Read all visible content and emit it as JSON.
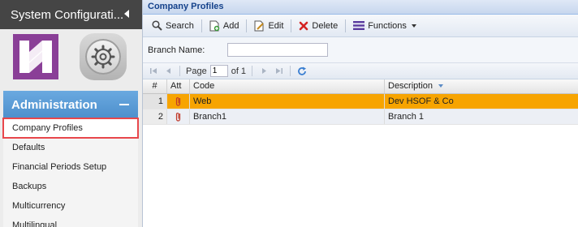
{
  "sidebar": {
    "title": "System Configurati...",
    "section": "Administration",
    "items": [
      {
        "label": "Company Profiles"
      },
      {
        "label": "Defaults"
      },
      {
        "label": "Financial Periods Setup"
      },
      {
        "label": "Backups"
      },
      {
        "label": "Multicurrency"
      },
      {
        "label": "Multilingual"
      }
    ]
  },
  "panel": {
    "title": "Company Profiles"
  },
  "toolbar": {
    "search": "Search",
    "add": "Add",
    "edit": "Edit",
    "delete": "Delete",
    "functions": "Functions"
  },
  "filter": {
    "branch_name_label": "Branch Name:",
    "branch_name_value": ""
  },
  "pager": {
    "page_label": "Page",
    "page_value": "1",
    "of_label": "of 1"
  },
  "grid": {
    "columns": {
      "num": "#",
      "att": "Att",
      "code": "Code",
      "description": "Description"
    },
    "rows": [
      {
        "num": "1",
        "code": "Web",
        "description": "Dev HSOF & Co"
      },
      {
        "num": "2",
        "code": "Branch1",
        "description": "Branch 1"
      }
    ]
  },
  "colors": {
    "accent": "#5b9bd5",
    "selected_row": "#f7a400",
    "highlight_outline": "#e8474c"
  }
}
